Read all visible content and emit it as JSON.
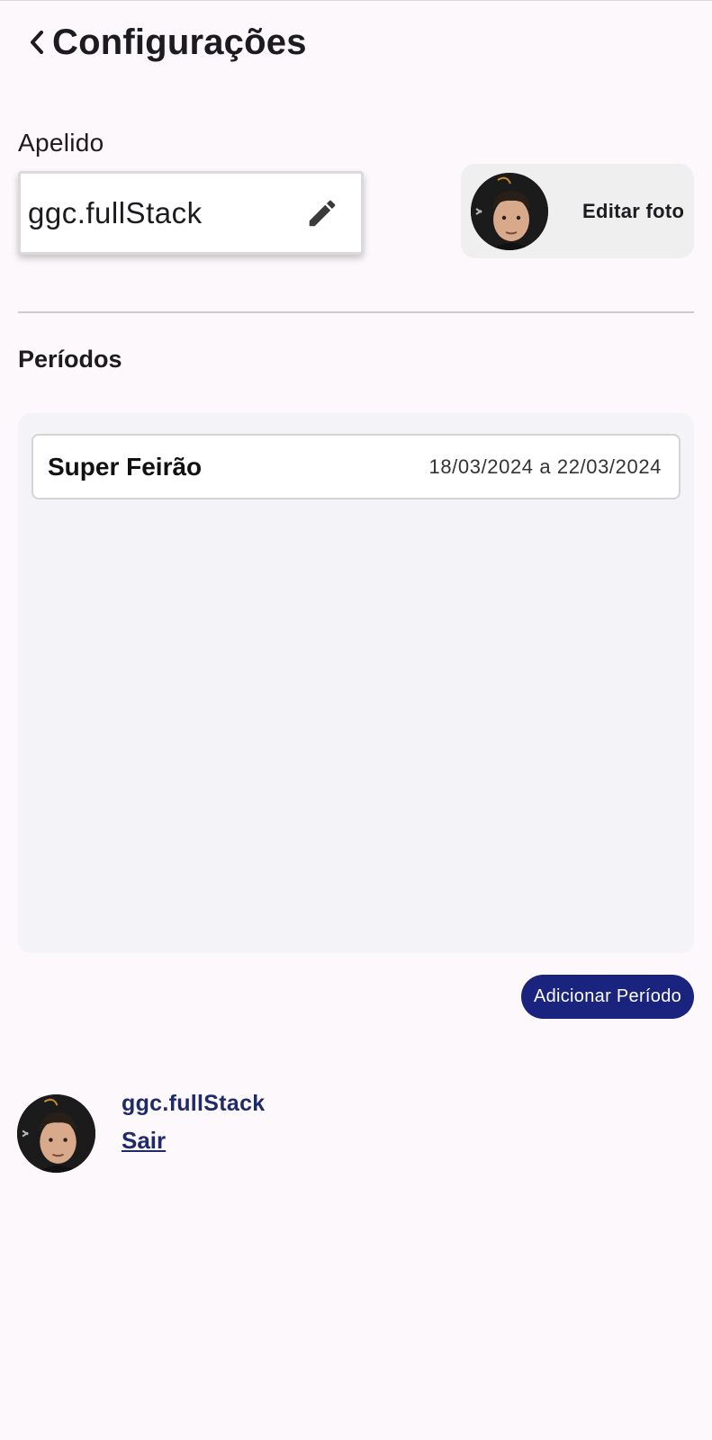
{
  "header": {
    "title": "Configurações",
    "back_icon": "chevron-left-icon"
  },
  "nickname": {
    "label": "Apelido",
    "value": "ggc.fullStack",
    "edit_icon": "pencil-icon"
  },
  "photo": {
    "label": "Editar foto"
  },
  "periods": {
    "heading": "Períodos",
    "items": [
      {
        "name": "Super Feirão",
        "dates": "18/03/2024 a 22/03/2024"
      }
    ],
    "add_label": "Adicionar Período"
  },
  "footer": {
    "username": "ggc.fullStack",
    "logout_label": "Sair"
  },
  "colors": {
    "background": "#fcf8fc",
    "primary": "#1a237e",
    "footer_text": "#1f2a6b",
    "panel": "#f4f4f8"
  }
}
